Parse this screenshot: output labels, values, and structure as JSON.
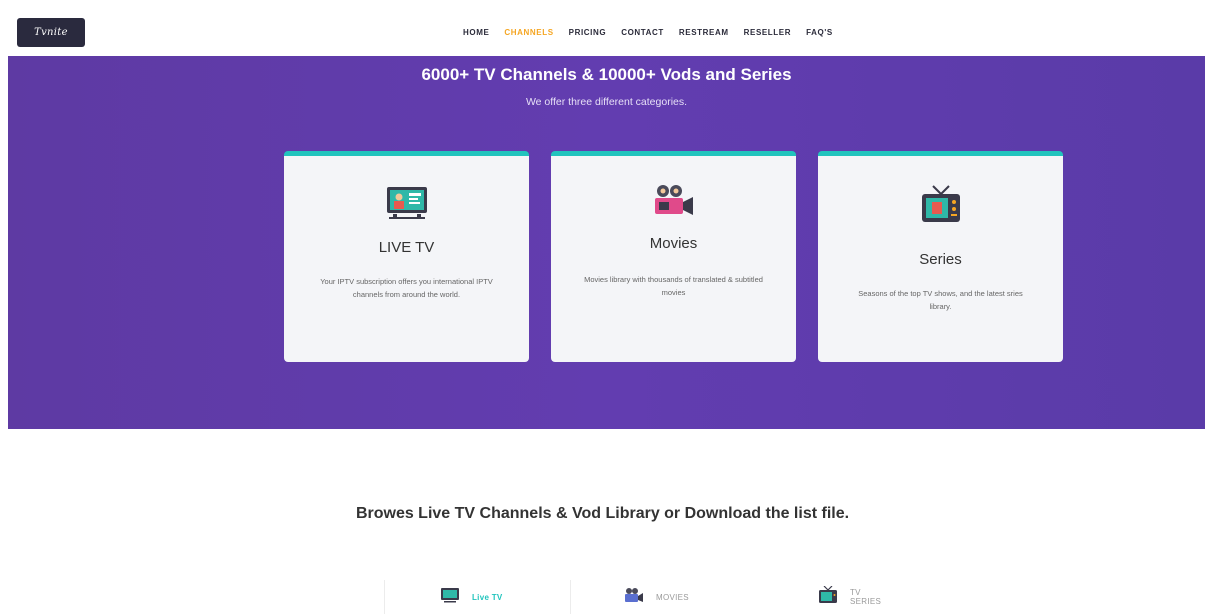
{
  "brand": {
    "logo_text": "Tvnite"
  },
  "nav": {
    "items": [
      "HOME",
      "CHANNELS",
      "PRICING",
      "CONTACT",
      "RESTREAM",
      "RESELLER",
      "FAQ'S"
    ],
    "active_index": 1
  },
  "hero": {
    "title": "6000+ TV Channels & 10000+ Vods and Series",
    "subtitle": "We offer three different categories."
  },
  "cards": [
    {
      "title": "LIVE TV",
      "icon": "live-tv-icon",
      "description": "Your IPTV subscription offers you international IPTV channels from around the world."
    },
    {
      "title": "Movies",
      "icon": "movie-camera-icon",
      "description": "Movies library with thousands of translated & subtitled movies"
    },
    {
      "title": "Series",
      "icon": "retro-tv-icon",
      "description": "Seasons of the top TV shows, and the latest sries library."
    }
  ],
  "browse": {
    "title": "Browes Live TV Channels & Vod Library or Download the list file.",
    "tabs": [
      {
        "label": "Live TV",
        "icon": "live-tv-icon",
        "active": true
      },
      {
        "label": "MOVIES",
        "icon": "movie-camera-icon",
        "active": false
      },
      {
        "label": "TV SERIES",
        "icon": "retro-tv-icon",
        "active": false
      }
    ]
  },
  "colors": {
    "hero_purple": "#623db0",
    "accent_teal": "#21c4bd",
    "nav_active": "#f5a623",
    "card_bg": "#f4f5f8"
  }
}
